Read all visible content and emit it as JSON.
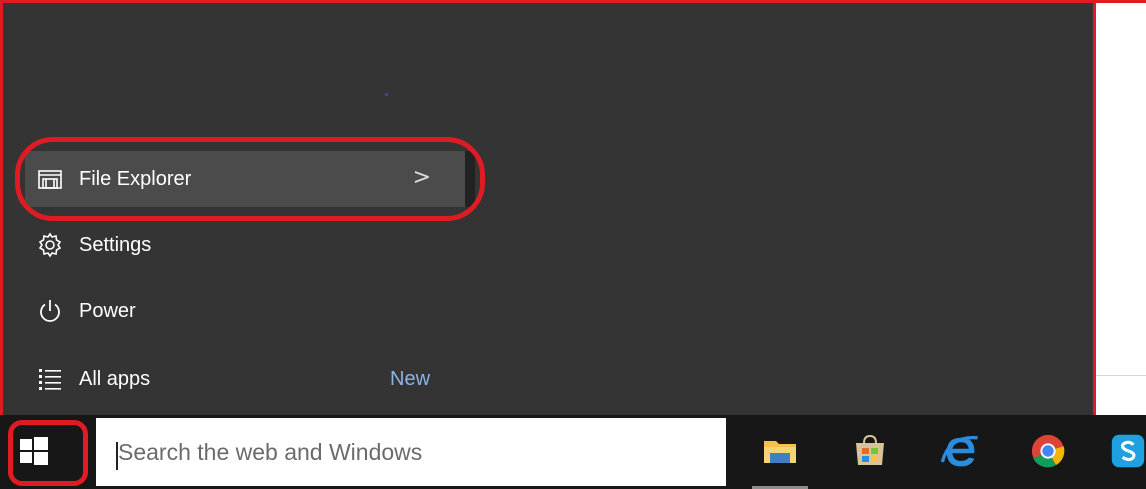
{
  "start_menu": {
    "items": [
      {
        "id": "file-explorer",
        "label": "File Explorer",
        "icon": "folder-icon",
        "has_submenu": true
      },
      {
        "id": "settings",
        "label": "Settings",
        "icon": "gear-icon"
      },
      {
        "id": "power",
        "label": "Power",
        "icon": "power-icon"
      },
      {
        "id": "all-apps",
        "label": "All apps",
        "icon": "list-icon",
        "badge": "New"
      }
    ],
    "submenu_glyph": ">"
  },
  "taskbar": {
    "search_placeholder": "Search the web and Windows",
    "pinned_apps": [
      "file-explorer-icon",
      "store-icon",
      "internet-explorer-icon",
      "chrome-icon",
      "skype-icon"
    ]
  },
  "colors": {
    "annotation": "#e01b24",
    "menu_bg": "#343434",
    "taskbar_bg": "#171717",
    "accent_text": "#8ab4e6"
  }
}
